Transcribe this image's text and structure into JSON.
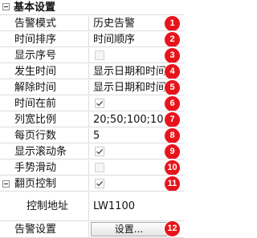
{
  "section": {
    "title": "基本设置",
    "collapse_glyph": "minus"
  },
  "rows": [
    {
      "label": "告警模式",
      "value": "历史告警",
      "badge": "1"
    },
    {
      "label": "时间排序",
      "value": "时间顺序",
      "badge": "2"
    },
    {
      "label": "显示序号",
      "checked": false,
      "badge": "3"
    },
    {
      "label": "发生时间",
      "value": "显示日期和时间",
      "badge": "4"
    },
    {
      "label": "解除时间",
      "value": "显示日期和时间",
      "badge": "5"
    },
    {
      "label": "时间在前",
      "checked": true,
      "badge": "6"
    },
    {
      "label": "列宽比例",
      "value": "20;50;100;100;",
      "badge": "7"
    },
    {
      "label": "每页行数",
      "value": "5",
      "badge": "8"
    },
    {
      "label": "显示滚动条",
      "checked": true,
      "badge": "9"
    },
    {
      "label": "手势滑动",
      "checked": false,
      "badge": "10"
    },
    {
      "label": "翻页控制",
      "checked": true,
      "badge": "11"
    },
    {
      "label": "控制地址",
      "value": "LW1100"
    },
    {
      "label": "告警设置",
      "button": "设置...",
      "badge": "12"
    }
  ],
  "colors": {
    "badge": "#e8141b",
    "grid": "#dcdcdc"
  }
}
